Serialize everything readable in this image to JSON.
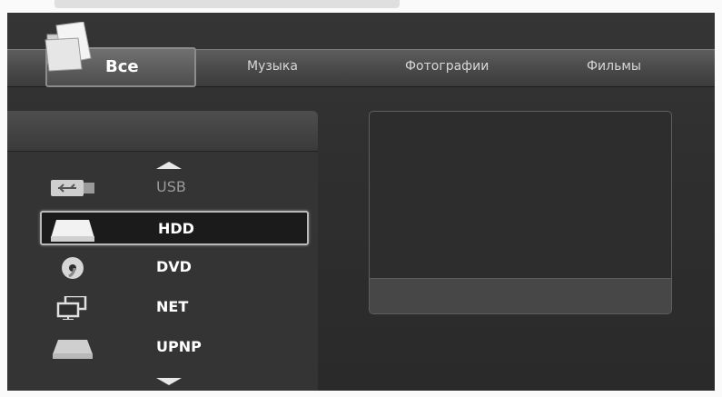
{
  "tabs": {
    "active": "Все",
    "music": "Музыка",
    "photos": "Фотографии",
    "movies": "Фильмы"
  },
  "sources": [
    {
      "label": "USB",
      "icon": "usb-icon",
      "state": "dimmed"
    },
    {
      "label": "HDD",
      "icon": "hdd-icon",
      "state": "selected"
    },
    {
      "label": "DVD",
      "icon": "dvd-icon",
      "state": "normal"
    },
    {
      "label": "NET",
      "icon": "network-icon",
      "state": "normal"
    },
    {
      "label": "UPNP",
      "icon": "upnp-icon",
      "state": "normal"
    }
  ],
  "colors": {
    "background": "#2c2c2c",
    "tab_bar": "#4a4a4a",
    "selection_border": "#b9b9b9"
  }
}
